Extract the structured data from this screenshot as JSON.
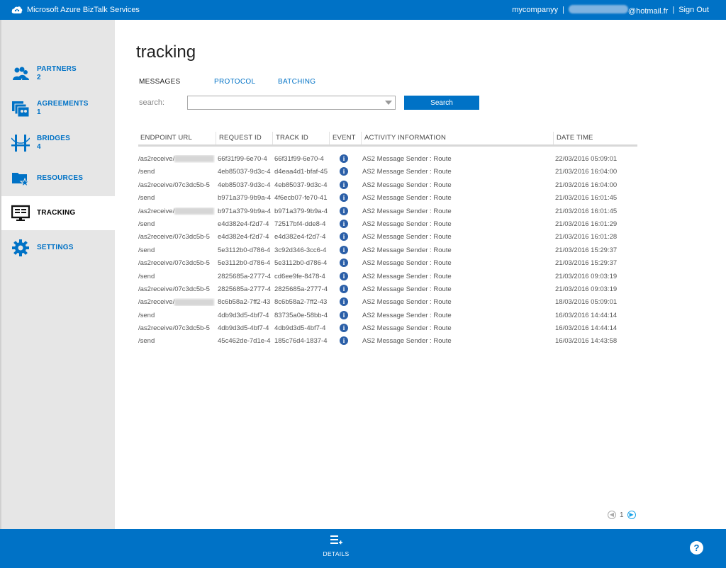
{
  "app": {
    "title": "Microsoft Azure BizTalk Services",
    "account": "mycompanyy",
    "email_suffix": "@hotmail.fr",
    "separator": "|",
    "sign_out": "Sign Out",
    "accent_color": "#0072c6"
  },
  "sidebar": {
    "items": [
      {
        "label": "PARTNERS",
        "count": "2",
        "icon": "partners-icon"
      },
      {
        "label": "AGREEMENTS",
        "count": "1",
        "icon": "agreements-icon"
      },
      {
        "label": "BRIDGES",
        "count": "4",
        "icon": "bridge-icon"
      },
      {
        "label": "RESOURCES",
        "count": "",
        "icon": "resources-icon"
      },
      {
        "label": "TRACKING",
        "count": "",
        "icon": "monitor-icon",
        "active": true
      },
      {
        "label": "SETTINGS",
        "count": "",
        "icon": "gear-icon"
      }
    ]
  },
  "page": {
    "title": "tracking",
    "tabs": [
      "MESSAGES",
      "PROTOCOL",
      "BATCHING"
    ],
    "search_label": "search:",
    "search_value": "",
    "search_button": "Search"
  },
  "table": {
    "columns": [
      "ENDPOINT URL",
      "REQUEST ID",
      "TRACK ID",
      "EVENT",
      "ACTIVITY INFORMATION",
      "DATE TIME"
    ],
    "rows": [
      {
        "endpoint": "/as2receive/",
        "masked": true,
        "request": "66f31f99-6e70-4",
        "track": "66f31f99-6e70-4",
        "event": "i",
        "activity": "AS2 Message Sender : Route",
        "datetime": "22/03/2016 05:09:01"
      },
      {
        "endpoint": "/send",
        "masked": false,
        "request": "4eb85037-9d3c-4",
        "track": "d4eaa4d1-bfaf-45",
        "event": "i",
        "activity": "AS2 Message Sender : Route",
        "datetime": "21/03/2016 16:04:00"
      },
      {
        "endpoint": "/as2receive/07c3dc5b-5",
        "masked": false,
        "request": "4eb85037-9d3c-4",
        "track": "4eb85037-9d3c-4",
        "event": "i",
        "activity": "AS2 Message Sender : Route",
        "datetime": "21/03/2016 16:04:00"
      },
      {
        "endpoint": "/send",
        "masked": false,
        "request": "b971a379-9b9a-4",
        "track": "4f6ecb07-fe70-41",
        "event": "i",
        "activity": "AS2 Message Sender : Route",
        "datetime": "21/03/2016 16:01:45"
      },
      {
        "endpoint": "/as2receive/",
        "masked": true,
        "request": "b971a379-9b9a-4",
        "track": "b971a379-9b9a-4",
        "event": "i",
        "activity": "AS2 Message Sender : Route",
        "datetime": "21/03/2016 16:01:45"
      },
      {
        "endpoint": "/send",
        "masked": false,
        "request": "e4d382e4-f2d7-4",
        "track": "72517bf4-dde8-4",
        "event": "i",
        "activity": "AS2 Message Sender : Route",
        "datetime": "21/03/2016 16:01:29"
      },
      {
        "endpoint": "/as2receive/07c3dc5b-5",
        "masked": false,
        "request": "e4d382e4-f2d7-4",
        "track": "e4d382e4-f2d7-4",
        "event": "i",
        "activity": "AS2 Message Sender : Route",
        "datetime": "21/03/2016 16:01:28"
      },
      {
        "endpoint": "/send",
        "masked": false,
        "request": "5e3112b0-d786-4",
        "track": "3c92d346-3cc6-4",
        "event": "i",
        "activity": "AS2 Message Sender : Route",
        "datetime": "21/03/2016 15:29:37"
      },
      {
        "endpoint": "/as2receive/07c3dc5b-5",
        "masked": false,
        "request": "5e3112b0-d786-4",
        "track": "5e3112b0-d786-4",
        "event": "i",
        "activity": "AS2 Message Sender : Route",
        "datetime": "21/03/2016 15:29:37"
      },
      {
        "endpoint": "/send",
        "masked": false,
        "request": "2825685a-2777-4",
        "track": "cd6ee9fe-8478-4",
        "event": "i",
        "activity": "AS2 Message Sender : Route",
        "datetime": "21/03/2016 09:03:19"
      },
      {
        "endpoint": "/as2receive/07c3dc5b-5",
        "masked": false,
        "request": "2825685a-2777-4",
        "track": "2825685a-2777-4",
        "event": "i",
        "activity": "AS2 Message Sender : Route",
        "datetime": "21/03/2016 09:03:19"
      },
      {
        "endpoint": "/as2receive/",
        "masked": true,
        "request": "8c6b58a2-7ff2-43",
        "track": "8c6b58a2-7ff2-43",
        "event": "i",
        "activity": "AS2 Message Sender : Route",
        "datetime": "18/03/2016 05:09:01"
      },
      {
        "endpoint": "/send",
        "masked": false,
        "request": "4db9d3d5-4bf7-4",
        "track": "83735a0e-58bb-4",
        "event": "i",
        "activity": "AS2 Message Sender : Route",
        "datetime": "16/03/2016 14:44:14"
      },
      {
        "endpoint": "/as2receive/07c3dc5b-5",
        "masked": false,
        "request": "4db9d3d5-4bf7-4",
        "track": "4db9d3d5-4bf7-4",
        "event": "i",
        "activity": "AS2 Message Sender : Route",
        "datetime": "16/03/2016 14:44:14"
      },
      {
        "endpoint": "/send",
        "masked": false,
        "request": "45c462de-7d1e-4",
        "track": "185c76d4-1837-4",
        "event": "i",
        "activity": "AS2 Message Sender : Route",
        "datetime": "16/03/2016 14:43:58"
      }
    ]
  },
  "pager": {
    "current": "1",
    "prev_icon": "arrow-left-icon",
    "next_icon": "arrow-right-icon"
  },
  "bottom": {
    "details_label": "DETAILS",
    "help_label": "?"
  }
}
